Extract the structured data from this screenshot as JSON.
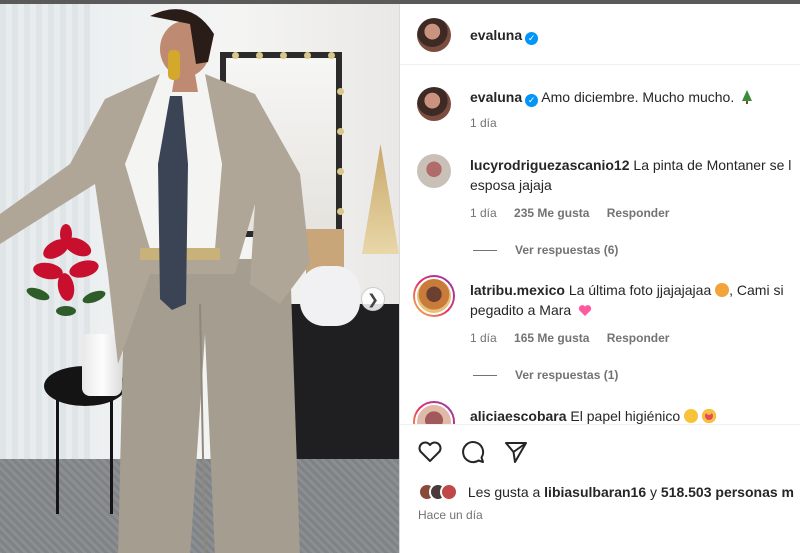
{
  "header": {
    "username": "evaluna",
    "verified": true
  },
  "caption": {
    "username": "evaluna",
    "text": "Amo diciembre. Mucho mucho.",
    "emoji_icon": "christmas-tree-icon",
    "time": "1 día"
  },
  "comments": [
    {
      "username": "lucyrodriguezascanio12",
      "text_line1": "La pinta de Montaner se l",
      "text_line2": "esposa jajaja",
      "time": "1 día",
      "likes": "235 Me gusta",
      "reply_label": "Responder",
      "view_replies": "Ver respuestas (6)"
    },
    {
      "username": "latribu.mexico",
      "text_line1": "La última foto jjajajajaa",
      "text_line1_suffix": ", Cami si",
      "text_line2": "pegadito a Mara",
      "time": "1 día",
      "likes": "165 Me gusta",
      "reply_label": "Responder",
      "view_replies": "Ver respuestas (1)"
    },
    {
      "username": "aliciaescobara",
      "text_line1": "El papel higiénico"
    }
  ],
  "likes_summary": {
    "prefix": "Les gusta a",
    "first_user": "libiasulbaran16",
    "connector": "y",
    "others": "518.503 personas m"
  },
  "post_time": "Hace un día",
  "colors": {
    "verified_blue": "#0095f6",
    "meta_gray": "#737373",
    "text_dark": "#262626",
    "heart_pink": "#ff5aa0"
  }
}
